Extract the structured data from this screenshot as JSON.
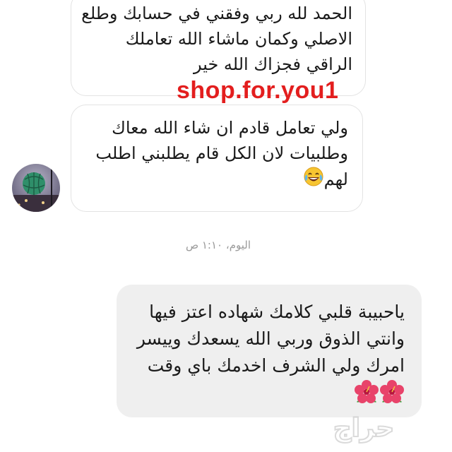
{
  "messages": [
    {
      "lines": [
        "الحمد لله ربي وفقني في حسابك وطلع",
        "الاصلي وكمان ماشاء الله تعاملك",
        "الراقي فجزاك الله خير"
      ]
    },
    {
      "lines": [
        "ولي تعامل قادم ان شاء الله معاك",
        "وطلبيات لان الكل قام يطلبني اطلب",
        "لهم"
      ]
    },
    {
      "lines": [
        "ياحبيبة قلبي كلامك شهاده اعتز فيها",
        "وانتي الذوق وربي الله يسعدك وييسر",
        "امرك ولي الشرف اخدمك باي وقت"
      ]
    }
  ],
  "timestamp": "اليوم، ١:١٠ ص",
  "watermark_text": "shop.for.you1",
  "haraj_logo_text": "حراج",
  "icons": {
    "avatar": "globe-avatar",
    "laugh": "tears-of-joy-emoji",
    "flower": "hibiscus-emoji"
  }
}
